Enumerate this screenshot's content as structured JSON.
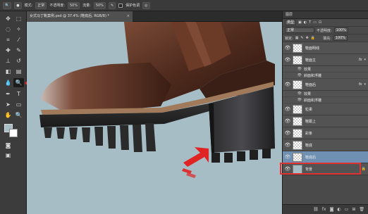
{
  "options_bar": {
    "mode_label": "正常",
    "mode_prefix": "模式:",
    "opacity_label": "不透明度:",
    "opacity_value": "50%",
    "flow_label": "流量:",
    "flow_value": "50%",
    "protect_label": "保护色调"
  },
  "document": {
    "tab_title": "女式马丁靴案例.psd @ 37.4% (鞋底后, RGB/8) *",
    "close_label": "×"
  },
  "layers_panel": {
    "title": "图层",
    "filter_kind": "类型",
    "blend_mode": "正常",
    "opacity_label": "不透明度:",
    "opacity_value": "100%",
    "lock_label": "锁定:",
    "fill_label": "填充:",
    "fill_value": "100%",
    "layers": [
      {
        "name": "鞋面明线",
        "fx": false,
        "effects": []
      },
      {
        "name": "鞋面主",
        "fx": true,
        "effects": [
          "效果",
          "斜面和浮雕"
        ]
      },
      {
        "name": "鞋面后",
        "fx": true,
        "effects": [
          "效果",
          "斜面和浮雕"
        ]
      },
      {
        "name": "粒柔",
        "fx": false,
        "effects": []
      },
      {
        "name": "鞋跟上",
        "fx": false,
        "effects": []
      },
      {
        "name": "彩条",
        "fx": false,
        "effects": []
      },
      {
        "name": "鞋底",
        "fx": false,
        "effects": []
      },
      {
        "name": "鞋底后",
        "fx": false,
        "effects": [],
        "selected": true
      },
      {
        "name": "背景",
        "fx": false,
        "effects": [],
        "locked": true
      }
    ],
    "fx_label": "fx",
    "lock_icon": "🔒"
  },
  "colors": {
    "canvas_bg": "#a7bdc6",
    "selection_blue": "#6f8fb3",
    "highlight_red": "#e13232",
    "arrow_red": "#e02424",
    "boot_brown": "#5b3425"
  }
}
